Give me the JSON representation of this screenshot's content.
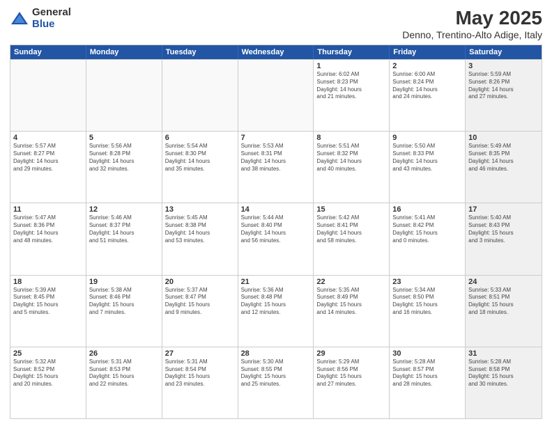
{
  "logo": {
    "general": "General",
    "blue": "Blue"
  },
  "title": {
    "month": "May 2025",
    "location": "Denno, Trentino-Alto Adige, Italy"
  },
  "header_days": [
    "Sunday",
    "Monday",
    "Tuesday",
    "Wednesday",
    "Thursday",
    "Friday",
    "Saturday"
  ],
  "weeks": [
    [
      {
        "day": "",
        "info": "",
        "empty": true
      },
      {
        "day": "",
        "info": "",
        "empty": true
      },
      {
        "day": "",
        "info": "",
        "empty": true
      },
      {
        "day": "",
        "info": "",
        "empty": true
      },
      {
        "day": "1",
        "info": "Sunrise: 6:02 AM\nSunset: 8:23 PM\nDaylight: 14 hours\nand 21 minutes.",
        "empty": false
      },
      {
        "day": "2",
        "info": "Sunrise: 6:00 AM\nSunset: 8:24 PM\nDaylight: 14 hours\nand 24 minutes.",
        "empty": false
      },
      {
        "day": "3",
        "info": "Sunrise: 5:59 AM\nSunset: 8:26 PM\nDaylight: 14 hours\nand 27 minutes.",
        "empty": false,
        "shaded": true
      }
    ],
    [
      {
        "day": "4",
        "info": "Sunrise: 5:57 AM\nSunset: 8:27 PM\nDaylight: 14 hours\nand 29 minutes.",
        "empty": false
      },
      {
        "day": "5",
        "info": "Sunrise: 5:56 AM\nSunset: 8:28 PM\nDaylight: 14 hours\nand 32 minutes.",
        "empty": false
      },
      {
        "day": "6",
        "info": "Sunrise: 5:54 AM\nSunset: 8:30 PM\nDaylight: 14 hours\nand 35 minutes.",
        "empty": false
      },
      {
        "day": "7",
        "info": "Sunrise: 5:53 AM\nSunset: 8:31 PM\nDaylight: 14 hours\nand 38 minutes.",
        "empty": false
      },
      {
        "day": "8",
        "info": "Sunrise: 5:51 AM\nSunset: 8:32 PM\nDaylight: 14 hours\nand 40 minutes.",
        "empty": false
      },
      {
        "day": "9",
        "info": "Sunrise: 5:50 AM\nSunset: 8:33 PM\nDaylight: 14 hours\nand 43 minutes.",
        "empty": false
      },
      {
        "day": "10",
        "info": "Sunrise: 5:49 AM\nSunset: 8:35 PM\nDaylight: 14 hours\nand 46 minutes.",
        "empty": false,
        "shaded": true
      }
    ],
    [
      {
        "day": "11",
        "info": "Sunrise: 5:47 AM\nSunset: 8:36 PM\nDaylight: 14 hours\nand 48 minutes.",
        "empty": false
      },
      {
        "day": "12",
        "info": "Sunrise: 5:46 AM\nSunset: 8:37 PM\nDaylight: 14 hours\nand 51 minutes.",
        "empty": false
      },
      {
        "day": "13",
        "info": "Sunrise: 5:45 AM\nSunset: 8:38 PM\nDaylight: 14 hours\nand 53 minutes.",
        "empty": false
      },
      {
        "day": "14",
        "info": "Sunrise: 5:44 AM\nSunset: 8:40 PM\nDaylight: 14 hours\nand 56 minutes.",
        "empty": false
      },
      {
        "day": "15",
        "info": "Sunrise: 5:42 AM\nSunset: 8:41 PM\nDaylight: 14 hours\nand 58 minutes.",
        "empty": false
      },
      {
        "day": "16",
        "info": "Sunrise: 5:41 AM\nSunset: 8:42 PM\nDaylight: 15 hours\nand 0 minutes.",
        "empty": false
      },
      {
        "day": "17",
        "info": "Sunrise: 5:40 AM\nSunset: 8:43 PM\nDaylight: 15 hours\nand 3 minutes.",
        "empty": false,
        "shaded": true
      }
    ],
    [
      {
        "day": "18",
        "info": "Sunrise: 5:39 AM\nSunset: 8:45 PM\nDaylight: 15 hours\nand 5 minutes.",
        "empty": false
      },
      {
        "day": "19",
        "info": "Sunrise: 5:38 AM\nSunset: 8:46 PM\nDaylight: 15 hours\nand 7 minutes.",
        "empty": false
      },
      {
        "day": "20",
        "info": "Sunrise: 5:37 AM\nSunset: 8:47 PM\nDaylight: 15 hours\nand 9 minutes.",
        "empty": false
      },
      {
        "day": "21",
        "info": "Sunrise: 5:36 AM\nSunset: 8:48 PM\nDaylight: 15 hours\nand 12 minutes.",
        "empty": false
      },
      {
        "day": "22",
        "info": "Sunrise: 5:35 AM\nSunset: 8:49 PM\nDaylight: 15 hours\nand 14 minutes.",
        "empty": false
      },
      {
        "day": "23",
        "info": "Sunrise: 5:34 AM\nSunset: 8:50 PM\nDaylight: 15 hours\nand 16 minutes.",
        "empty": false
      },
      {
        "day": "24",
        "info": "Sunrise: 5:33 AM\nSunset: 8:51 PM\nDaylight: 15 hours\nand 18 minutes.",
        "empty": false,
        "shaded": true
      }
    ],
    [
      {
        "day": "25",
        "info": "Sunrise: 5:32 AM\nSunset: 8:52 PM\nDaylight: 15 hours\nand 20 minutes.",
        "empty": false
      },
      {
        "day": "26",
        "info": "Sunrise: 5:31 AM\nSunset: 8:53 PM\nDaylight: 15 hours\nand 22 minutes.",
        "empty": false
      },
      {
        "day": "27",
        "info": "Sunrise: 5:31 AM\nSunset: 8:54 PM\nDaylight: 15 hours\nand 23 minutes.",
        "empty": false
      },
      {
        "day": "28",
        "info": "Sunrise: 5:30 AM\nSunset: 8:55 PM\nDaylight: 15 hours\nand 25 minutes.",
        "empty": false
      },
      {
        "day": "29",
        "info": "Sunrise: 5:29 AM\nSunset: 8:56 PM\nDaylight: 15 hours\nand 27 minutes.",
        "empty": false
      },
      {
        "day": "30",
        "info": "Sunrise: 5:28 AM\nSunset: 8:57 PM\nDaylight: 15 hours\nand 28 minutes.",
        "empty": false
      },
      {
        "day": "31",
        "info": "Sunrise: 5:28 AM\nSunset: 8:58 PM\nDaylight: 15 hours\nand 30 minutes.",
        "empty": false,
        "shaded": true
      }
    ]
  ]
}
